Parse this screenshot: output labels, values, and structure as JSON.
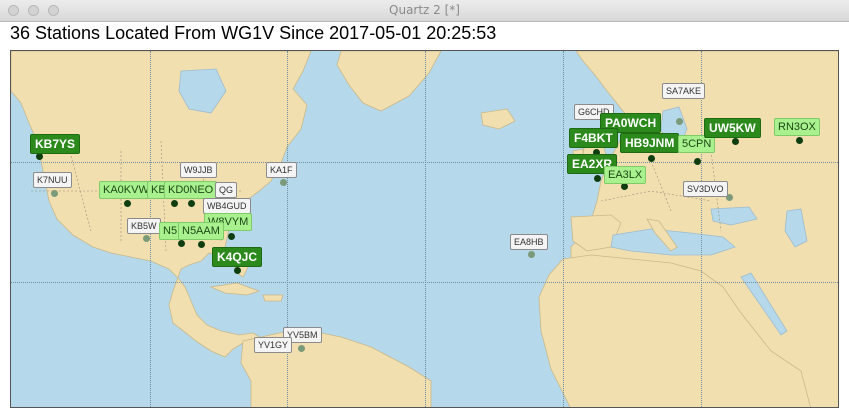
{
  "window": {
    "title": "Quartz 2 [*]",
    "buttons": [
      "close",
      "minimize",
      "zoom"
    ]
  },
  "heading": "36 Stations Located From  WG1V Since 2017-05-01 20:25:53",
  "colors": {
    "ocean": "#b5d8ea",
    "land": "#f2dfb0",
    "strong_label": "#2c8a1d",
    "medium_label": "#a9f08f",
    "weak_label": "#f4f4f4"
  },
  "stations": {
    "kb7ys": "KB7YS",
    "k7nuu": "K7NUU",
    "ka0kvw": "KA0KVW",
    "kb_partial": "KB",
    "kd0neo": "KD0NEO",
    "qg_partial": "QG",
    "w9jjb": "W9JJB",
    "ka1f": "KA1F",
    "wb4gud": "WB4GUD",
    "w8vym": "W8VYM",
    "kb5w": "KB5W",
    "n5_partial": "N5",
    "n5aam": "N5AAM",
    "k4qjc": "K4QJC",
    "ea8hb": "EA8HB",
    "yv5bm": "YV5BM",
    "yv1gy": "YV1GY",
    "g6chd": "G6CHD",
    "pa0wch": "PA0WCH",
    "f4bkt": "F4BKT",
    "hb9jnm": "HB9JNM",
    "s5cpn": "5CPN",
    "ea2xr": "EA2XR",
    "ea3lx": "EA3LX",
    "sa7ake": "SA7AKE",
    "uw5kw": "UW5KW",
    "rn3ox": "RN3OX",
    "sv3dvo": "SV3DVO"
  }
}
